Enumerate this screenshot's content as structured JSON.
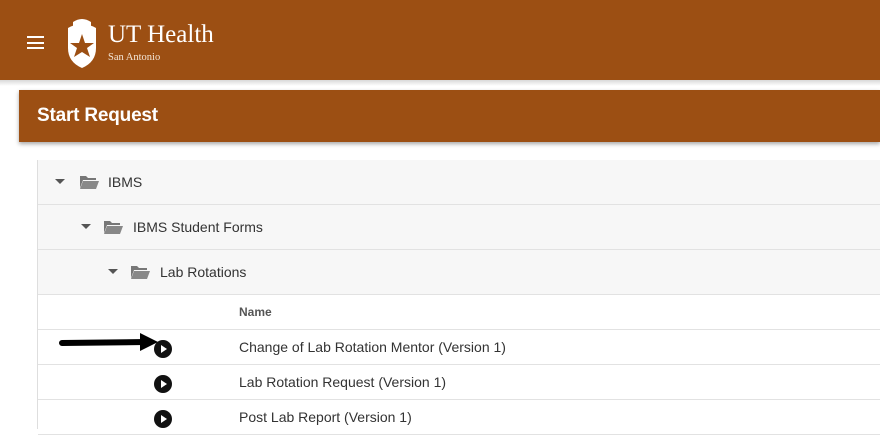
{
  "app": {
    "brand_name": "UT Health",
    "brand_sub": "San Antonio",
    "menu_icon": "hamburger-menu-icon"
  },
  "panel": {
    "title": "Start Request"
  },
  "tree": {
    "folders": [
      {
        "label": "IBMS",
        "icon": "folder-open-icon",
        "expanded": true
      },
      {
        "label": "IBMS Student Forms",
        "icon": "folder-open-icon",
        "expanded": true
      },
      {
        "label": "Lab Rotations",
        "icon": "folder-open-icon",
        "expanded": true
      }
    ],
    "column_header": "Name",
    "forms": [
      {
        "label": "Change of Lab Rotation Mentor (Version 1)",
        "icon": "play-circle-icon"
      },
      {
        "label": "Lab Rotation Request (Version 1)",
        "icon": "play-circle-icon"
      },
      {
        "label": "Post Lab Report (Version 1)",
        "icon": "play-circle-icon"
      }
    ]
  },
  "colors": {
    "brand": "#9c4f13",
    "folder_bg": "#f7f7f7"
  }
}
